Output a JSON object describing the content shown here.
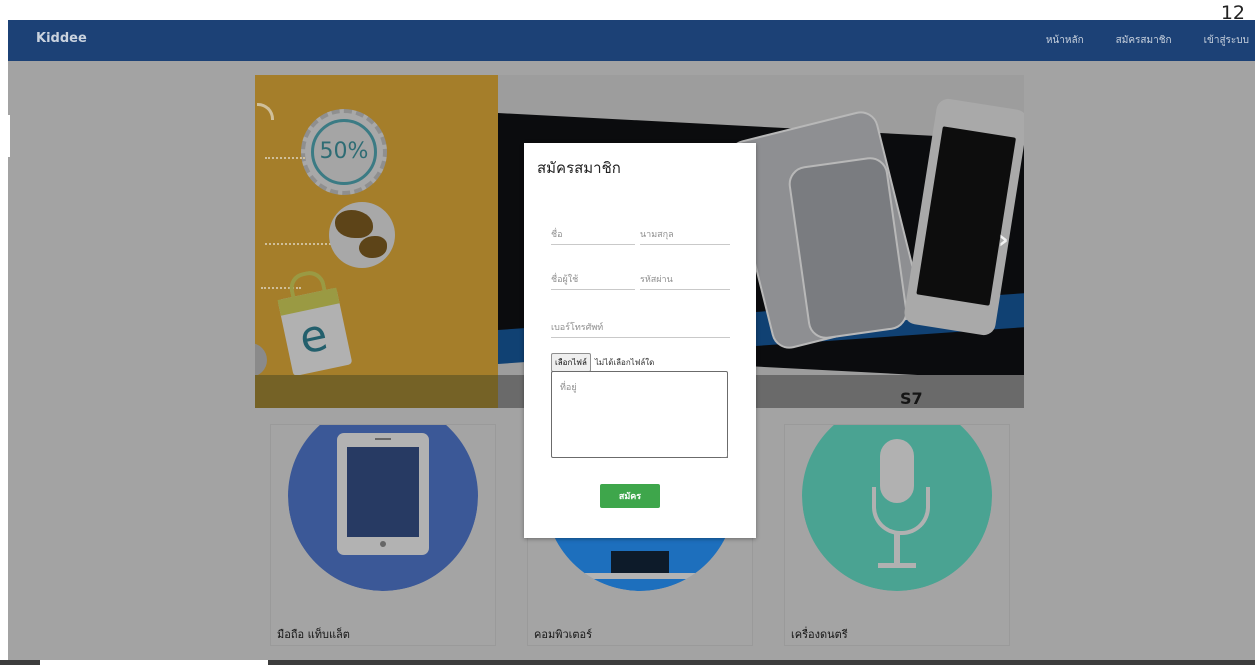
{
  "page_number": "12",
  "navbar": {
    "brand": "Kiddee",
    "links": [
      "หน้าหลัก",
      "สมัครสมาชิก",
      "เข้าสู่ระบบ"
    ]
  },
  "carousel": {
    "badge_text": "50%",
    "caption": "S7",
    "next_icon": "chevron-right-icon"
  },
  "categories": [
    {
      "label": "มือถือ แท็บแล็ต",
      "icon": "tablet-icon",
      "color": "#3b5897"
    },
    {
      "label": "คอมพิวเตอร์",
      "icon": "monitor-icon",
      "color": "#1d6fbd"
    },
    {
      "label": "เครื่องดนตรี",
      "icon": "microphone-icon",
      "color": "#4aa392"
    }
  ],
  "modal": {
    "title": "สมัครสมาชิก",
    "first_name_placeholder": "ชื่อ",
    "last_name_placeholder": "นามสกุล",
    "username_placeholder": "ชื่อผู้ใช้",
    "password_placeholder": "รหัสผ่าน",
    "phone_placeholder": "เบอร์โทรศัพท์",
    "file_button": "เลือกไฟล์",
    "file_status": "ไม่ได้เลือกไฟล์ใด",
    "address_placeholder": "ที่อยู่",
    "submit_label": "สมัคร",
    "submit_color": "#3ea64b"
  },
  "colors": {
    "navbar": "#1c4176",
    "overlay_gray": "#a3a3a3"
  }
}
